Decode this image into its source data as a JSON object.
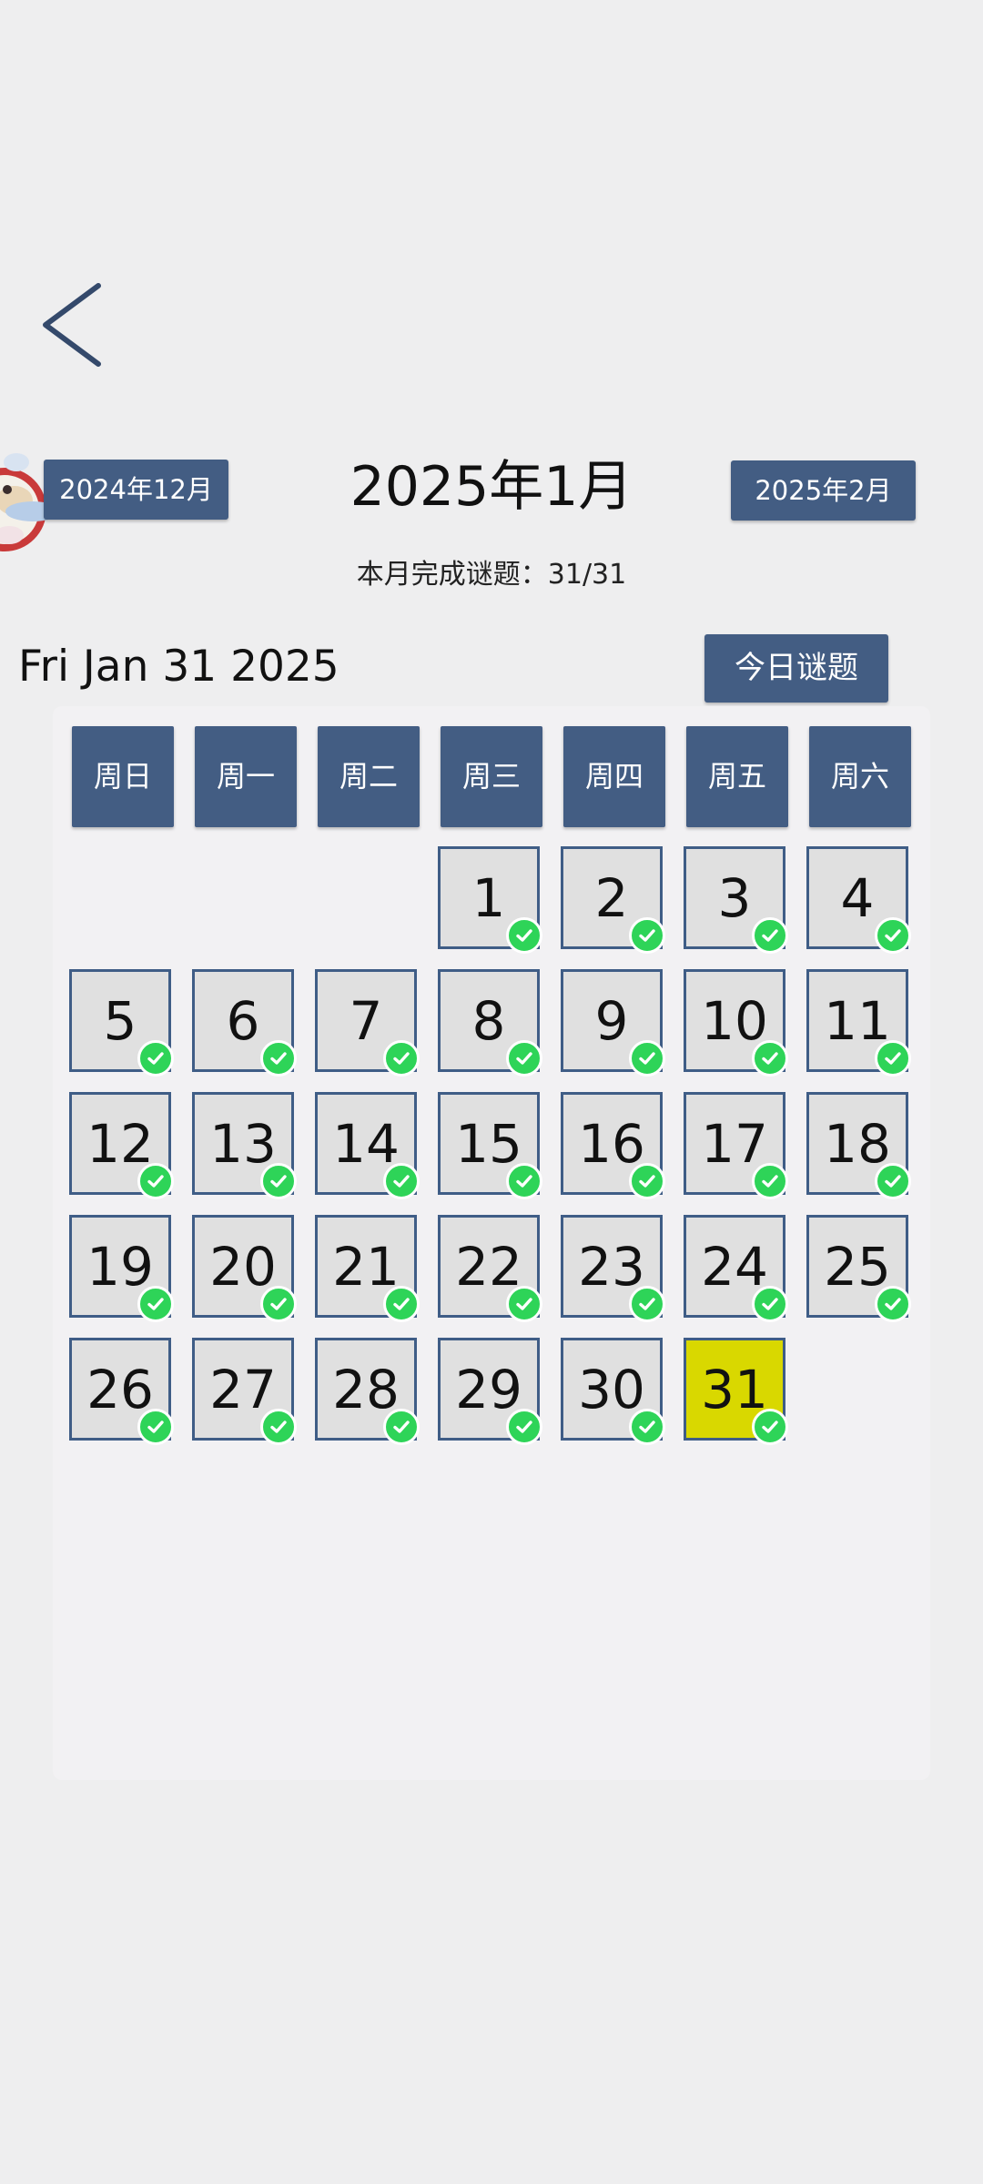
{
  "header": {
    "prev_month_label": "2024年12月",
    "month_title": "2025年1月",
    "next_month_label": "2025年2月",
    "progress_text": "本月完成谜题：31/31"
  },
  "today": {
    "date_text": "Fri Jan 31 2025",
    "button_label": "今日谜题"
  },
  "weekdays": [
    "周日",
    "周一",
    "周二",
    "周三",
    "周四",
    "周五",
    "周六"
  ],
  "calendar": {
    "first_weekday_index": 3,
    "selected_day": 31,
    "days": [
      {
        "label": "1",
        "completed": true
      },
      {
        "label": "2",
        "completed": true
      },
      {
        "label": "3",
        "completed": true
      },
      {
        "label": "4",
        "completed": true
      },
      {
        "label": "5",
        "completed": true
      },
      {
        "label": "6",
        "completed": true
      },
      {
        "label": "7",
        "completed": true
      },
      {
        "label": "8",
        "completed": true
      },
      {
        "label": "9",
        "completed": true
      },
      {
        "label": "10",
        "completed": true
      },
      {
        "label": "11",
        "completed": true
      },
      {
        "label": "12",
        "completed": true
      },
      {
        "label": "13",
        "completed": true
      },
      {
        "label": "14",
        "completed": true
      },
      {
        "label": "15",
        "completed": true
      },
      {
        "label": "16",
        "completed": true
      },
      {
        "label": "17",
        "completed": true
      },
      {
        "label": "18",
        "completed": true
      },
      {
        "label": "19",
        "completed": true
      },
      {
        "label": "20",
        "completed": true
      },
      {
        "label": "21",
        "completed": true
      },
      {
        "label": "22",
        "completed": true
      },
      {
        "label": "23",
        "completed": true
      },
      {
        "label": "24",
        "completed": true
      },
      {
        "label": "25",
        "completed": true
      },
      {
        "label": "26",
        "completed": true
      },
      {
        "label": "27",
        "completed": true
      },
      {
        "label": "28",
        "completed": true
      },
      {
        "label": "29",
        "completed": true
      },
      {
        "label": "30",
        "completed": true
      },
      {
        "label": "31",
        "completed": true
      }
    ]
  },
  "icons": {
    "back": "back-chevron-icon",
    "mascot": "mascot-avatar-icon",
    "check": "check-circle-icon"
  },
  "colors": {
    "accent": "#435d83",
    "day_border": "#3f5d86",
    "day_bg": "#e0e0e0",
    "selected_bg": "#d9d800",
    "check": "#2ed458"
  }
}
